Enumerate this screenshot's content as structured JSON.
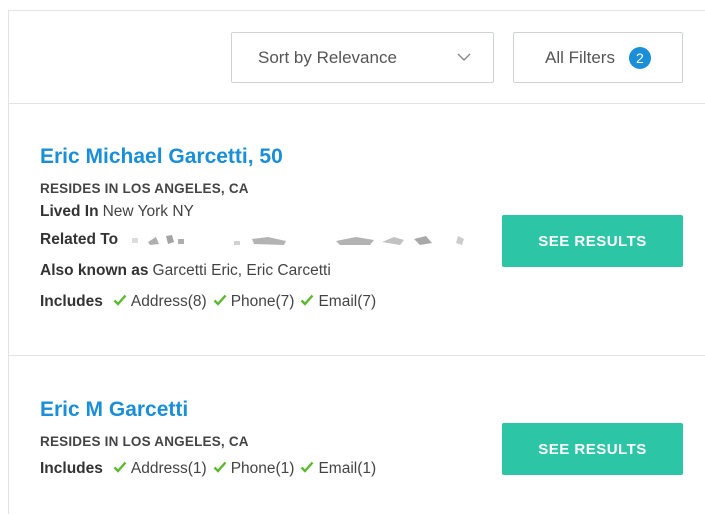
{
  "toolbar": {
    "sort_label": "Sort by Relevance",
    "filters_label": "All Filters",
    "filters_count": "2"
  },
  "results": [
    {
      "name": "Eric Michael Garcetti, 50",
      "resides": "RESIDES IN LOS ANGELES, CA",
      "lived_in_label": "Lived In",
      "lived_in_value": "New York NY",
      "related_to_label": "Related To",
      "aka_label": "Also known as",
      "aka_value": "Garcetti Eric, Eric Carcetti",
      "includes_label": "Includes",
      "includes": [
        "Address(8)",
        "Phone(7)",
        "Email(7)"
      ],
      "button_label": "SEE RESULTS"
    },
    {
      "name": "Eric M Garcetti",
      "resides": "RESIDES IN LOS ANGELES, CA",
      "includes_label": "Includes",
      "includes": [
        "Address(1)",
        "Phone(1)",
        "Email(1)"
      ],
      "button_label": "SEE RESULTS"
    }
  ],
  "colors": {
    "link": "#1a8fd8",
    "button": "#2cc5a6",
    "check": "#5cb82e",
    "badge": "#1a8fd8"
  },
  "icons": [
    "chevron-down-icon",
    "checkmark-icon"
  ]
}
